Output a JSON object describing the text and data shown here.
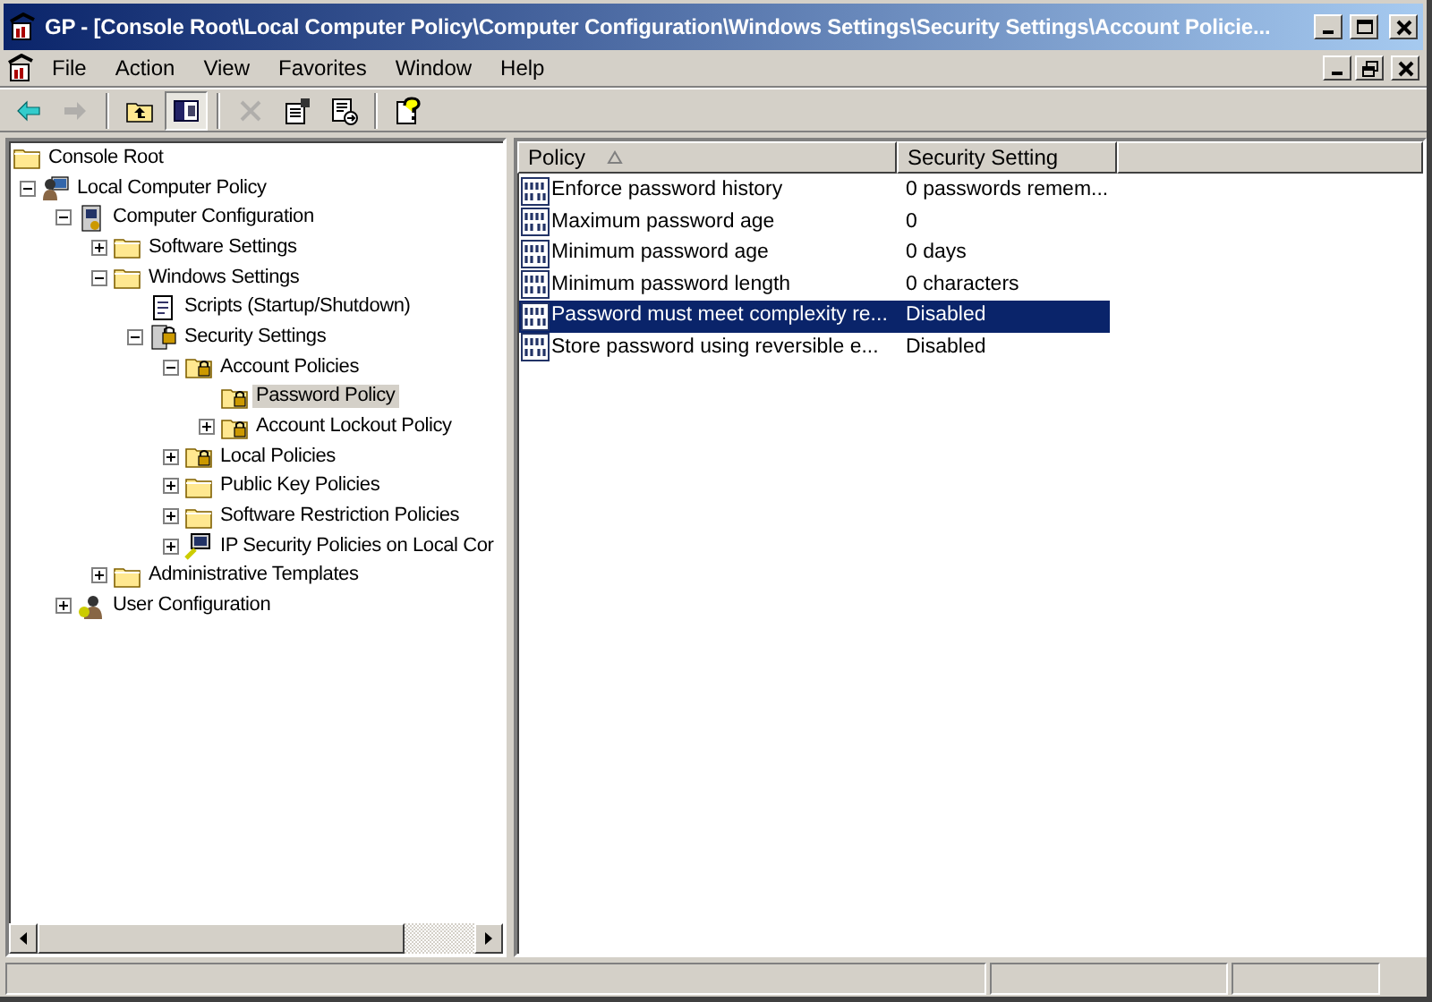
{
  "window": {
    "title": "GP - [Console Root\\Local Computer Policy\\Computer Configuration\\Windows Settings\\Security Settings\\Account Policie..."
  },
  "menu": [
    "File",
    "Action",
    "View",
    "Favorites",
    "Window",
    "Help"
  ],
  "toolbar": [
    {
      "kind": "back",
      "disabled": false,
      "pressed": false
    },
    {
      "kind": "forward",
      "disabled": true,
      "pressed": false
    },
    {
      "kind": "sep"
    },
    {
      "kind": "up",
      "disabled": false,
      "pressed": false
    },
    {
      "kind": "tree",
      "disabled": false,
      "pressed": true
    },
    {
      "kind": "sep"
    },
    {
      "kind": "delete",
      "disabled": true,
      "pressed": false
    },
    {
      "kind": "properties",
      "disabled": false,
      "pressed": false
    },
    {
      "kind": "export",
      "disabled": false,
      "pressed": false
    },
    {
      "kind": "sep"
    },
    {
      "kind": "help",
      "disabled": false,
      "pressed": false
    }
  ],
  "tree": [
    {
      "label": "Console Root",
      "kind": "folder",
      "selected": false,
      "children": [
        {
          "label": "Local Computer Policy",
          "kind": "policy",
          "selected": false,
          "expanded": true,
          "children": [
            {
              "label": "Computer Configuration",
              "kind": "computer",
              "selected": false,
              "expanded": true,
              "children": [
                {
                  "label": "Software Settings",
                  "kind": "folder",
                  "selected": false,
                  "expanded": false
                },
                {
                  "label": "Windows Settings",
                  "kind": "folder",
                  "selected": false,
                  "expanded": true,
                  "children": [
                    {
                      "label": "Scripts (Startup/Shutdown)",
                      "kind": "scripts",
                      "selected": false
                    },
                    {
                      "label": "Security Settings",
                      "kind": "security",
                      "selected": false,
                      "expanded": true,
                      "children": [
                        {
                          "label": "Account Policies",
                          "kind": "locked",
                          "selected": false,
                          "expanded": true,
                          "children": [
                            {
                              "label": "Password Policy",
                              "kind": "locked",
                              "selected": true
                            },
                            {
                              "label": "Account Lockout Policy",
                              "kind": "locked",
                              "selected": false,
                              "expanded": false
                            }
                          ]
                        },
                        {
                          "label": "Local Policies",
                          "kind": "locked",
                          "selected": false,
                          "expanded": false
                        },
                        {
                          "label": "Public Key Policies",
                          "kind": "folder",
                          "selected": false,
                          "expanded": false
                        },
                        {
                          "label": "Software Restriction Policies",
                          "kind": "folder",
                          "selected": false,
                          "expanded": false
                        },
                        {
                          "label": "IP Security Policies on Local Cor",
                          "kind": "ipsec",
                          "selected": false,
                          "expanded": false
                        }
                      ]
                    }
                  ]
                },
                {
                  "label": "Administrative Templates",
                  "kind": "folder",
                  "selected": false,
                  "expanded": false
                }
              ]
            },
            {
              "label": "User Configuration",
              "kind": "user",
              "selected": false,
              "expanded": false
            }
          ]
        }
      ]
    }
  ],
  "table": {
    "columns": [
      "Policy",
      "Security Setting"
    ],
    "rows": [
      {
        "policy": "Enforce password history",
        "setting": "0 passwords remem...",
        "selected": false
      },
      {
        "policy": "Maximum password age",
        "setting": "0",
        "selected": false
      },
      {
        "policy": "Minimum password age",
        "setting": "0 days",
        "selected": false
      },
      {
        "policy": "Minimum password length",
        "setting": "0 characters",
        "selected": false
      },
      {
        "policy": "Password must meet complexity re...",
        "setting": "Disabled",
        "selected": true
      },
      {
        "policy": "Store password using reversible e...",
        "setting": "Disabled",
        "selected": false
      }
    ]
  }
}
